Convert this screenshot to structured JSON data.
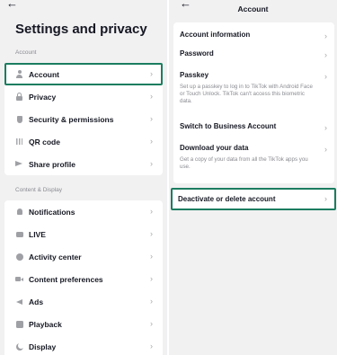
{
  "left": {
    "back_label": "←",
    "title": "Settings and privacy",
    "section_account": "Account",
    "account_items": [
      {
        "label": "Account",
        "icon": "person-icon"
      },
      {
        "label": "Privacy",
        "icon": "lock-icon"
      },
      {
        "label": "Security & permissions",
        "icon": "shield-icon"
      },
      {
        "label": "QR code",
        "icon": "qr-code-icon"
      },
      {
        "label": "Share profile",
        "icon": "share-icon"
      }
    ],
    "section_content": "Content & Display",
    "content_items": [
      {
        "label": "Notifications",
        "icon": "bell-icon"
      },
      {
        "label": "LIVE",
        "icon": "tv-icon"
      },
      {
        "label": "Activity center",
        "icon": "clock-icon"
      },
      {
        "label": "Content preferences",
        "icon": "video-camera-icon"
      },
      {
        "label": "Ads",
        "icon": "megaphone-icon"
      },
      {
        "label": "Playback",
        "icon": "playback-icon"
      },
      {
        "label": "Display",
        "icon": "moon-icon"
      }
    ]
  },
  "right": {
    "back_label": "←",
    "title": "Account",
    "items": [
      {
        "label": "Account information"
      },
      {
        "label": "Password"
      },
      {
        "label": "Passkey",
        "description": "Set up a passkey to log in to TikTok with Android Face or Touch Unlock. TikTok can't access this biometric data."
      },
      {
        "label": "Switch to Business Account"
      },
      {
        "label": "Download your data",
        "description": "Get a copy of your data from all the TikTok apps you use."
      }
    ],
    "deactivate_label": "Deactivate or delete account"
  },
  "chevron": "›",
  "colors": {
    "highlight": "#1b7d5f",
    "background": "#f1f1f2",
    "text": "#161823",
    "muted": "#8a8b91"
  }
}
